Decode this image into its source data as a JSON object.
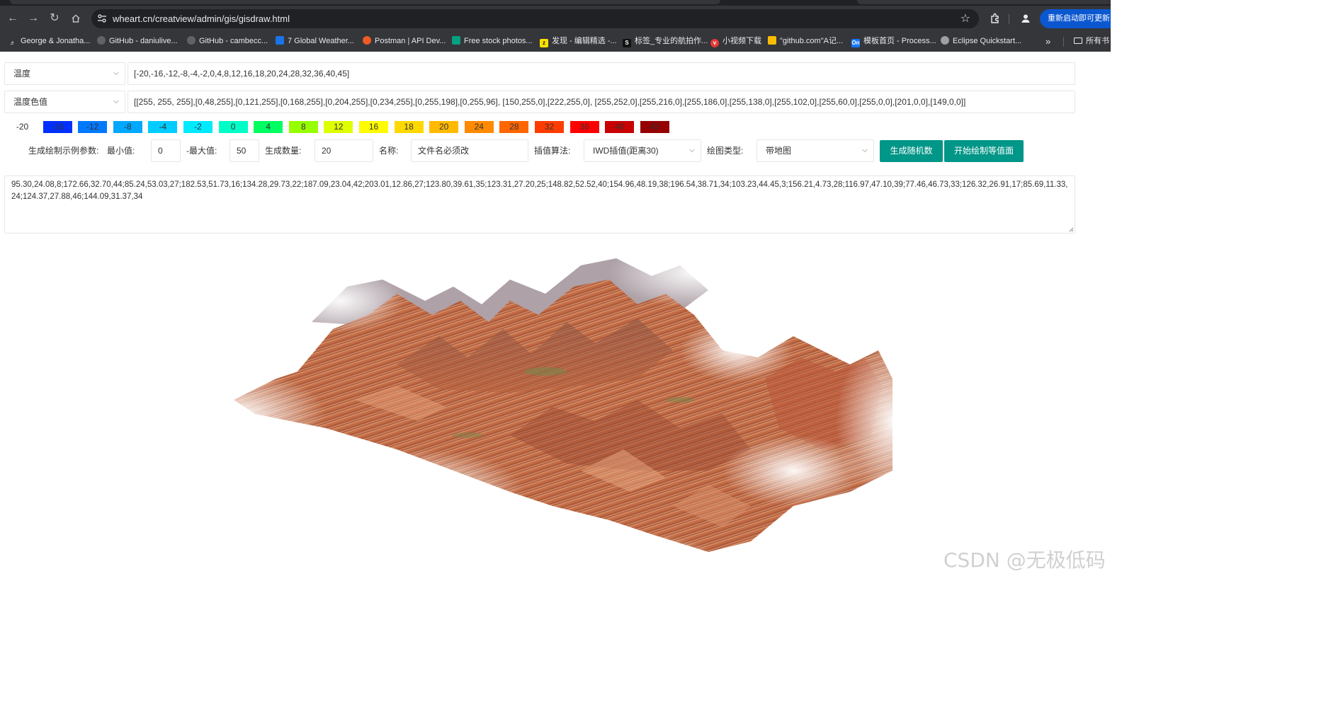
{
  "browser": {
    "url": "wheart.cn/creatview/admin/gis/gisdraw.html",
    "update_button": "重新启动即可更新",
    "bookmarks": [
      {
        "label": "George & Jonatha...",
        "icon": "app-favicon",
        "color": "#e8eaed"
      },
      {
        "label": "GitHub - daniulive...",
        "icon": "github-favicon",
        "color": "#5f6368"
      },
      {
        "label": "GitHub - cambecc...",
        "icon": "github-favicon",
        "color": "#5f6368"
      },
      {
        "label": "7 Global Weather...",
        "icon": "weather-favicon",
        "color": "#1a73e8"
      },
      {
        "label": "Postman | API Dev...",
        "icon": "postman-favicon",
        "color": "#ef5b25"
      },
      {
        "label": "Free stock photos...",
        "icon": "pexels-favicon",
        "color": "#05a081"
      },
      {
        "label": "发现 - 编辑精选 -...",
        "icon": "zcool-favicon",
        "color": "#ffe100"
      },
      {
        "label": "标签_专业的航拍作...",
        "icon": "skypixel-favicon",
        "color": "#111111"
      },
      {
        "label": "小视频下载",
        "icon": "download-favicon",
        "color": "#e53935"
      },
      {
        "label": "\"github.com\"A记...",
        "icon": "dns-favicon",
        "color": "#fbbc04"
      },
      {
        "label": "模板首页 - Process...",
        "icon": "processon-favicon",
        "color": "#1677ff"
      },
      {
        "label": "Eclipse Quickstart...",
        "icon": "globe-favicon",
        "color": "#9aa0a6"
      }
    ],
    "bookmarks_more": "»",
    "all_bookmarks": "所有书"
  },
  "form": {
    "field_select": "温度",
    "levels_text": "[-20,-16,-12,-8,-4,-2,0,4,8,12,16,18,20,24,28,32,36,40,45]",
    "color_select": "温度色值",
    "colors_text": "[[255, 255, 255],[0,48,255],[0,121,255],[0,168,255],[0,204,255],[0,234,255],[0,255,198],[0,255,96], [150,255,0],[222,255,0], [255,252,0],[255,216,0],[255,186,0],[255,138,0],[255,102,0],[255,60,0],[255,0,0],[201,0,0],[149,0,0]]"
  },
  "legend": [
    {
      "label": "-20",
      "color": "#ffffff"
    },
    {
      "label": "-16",
      "color": "#0030ff"
    },
    {
      "label": "-12",
      "color": "#0079ff"
    },
    {
      "label": "-8",
      "color": "#00a8ff"
    },
    {
      "label": "-4",
      "color": "#00ccff"
    },
    {
      "label": "-2",
      "color": "#00eaff"
    },
    {
      "label": "0",
      "color": "#00ffc6"
    },
    {
      "label": "4",
      "color": "#00ff60"
    },
    {
      "label": "8",
      "color": "#96ff00"
    },
    {
      "label": "12",
      "color": "#deff00"
    },
    {
      "label": "16",
      "color": "#fffc00"
    },
    {
      "label": "18",
      "color": "#ffd800"
    },
    {
      "label": "20",
      "color": "#ffba00"
    },
    {
      "label": "24",
      "color": "#ff8a00"
    },
    {
      "label": "28",
      "color": "#ff6600"
    },
    {
      "label": "32",
      "color": "#ff3c00"
    },
    {
      "label": "36",
      "color": "#ff0000"
    },
    {
      "label": "40",
      "color": "#c90000"
    },
    {
      "label": "45",
      "color": "#950000"
    }
  ],
  "params": {
    "title_label": "生成绘制示例参数:",
    "min_label": "最小值:",
    "min_value": "0",
    "max_label": "-最大值:",
    "max_value": "50",
    "count_label": "生成数量:",
    "count_value": "20",
    "name_label": "名称:",
    "name_value": "文件名必须改",
    "interp_label": "插值算法:",
    "interp_value": "IWD插值(距离30)",
    "plot_label": "绘图类型:",
    "plot_value": "带地图",
    "random_button": "生成随机数",
    "draw_button": "开始绘制等值面"
  },
  "data_text": "95.30,24.08,8;172.66,32.70,44;85.24,53.03,27;182.53,51.73,16;134.28,29.73,22;187.09,23.04,42;203.01,12.86,27;123.80,39.61,35;123.31,27.20,25;148.82,52.52,40;154.96,48.19,38;196.54,38.71,34;103.23,44.45,3;156.21,4.73,28;116.97,47.10,39;77.46,46.73,33;126.32,26.91,17;85.69,11.33,24;124.37,27.88,46;144.09,31.37,34",
  "watermark": "CSDN @无极低码"
}
